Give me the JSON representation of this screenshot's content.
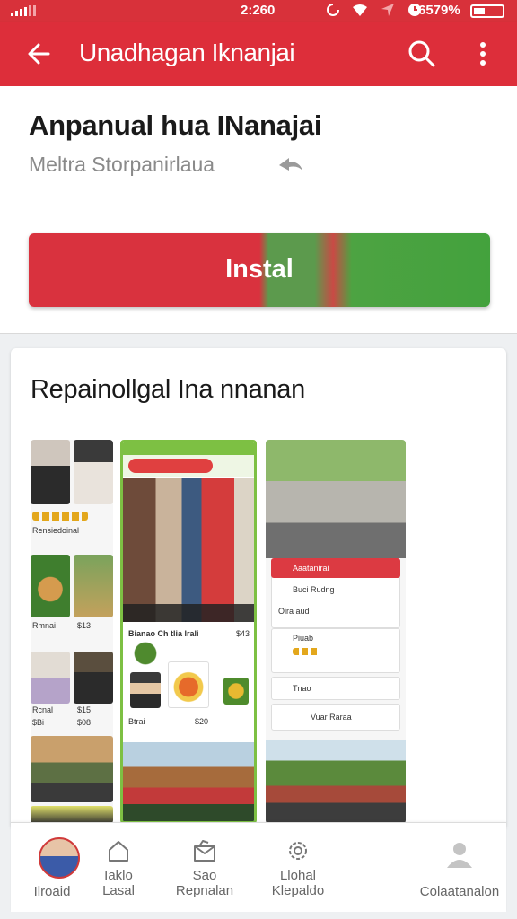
{
  "status_bar": {
    "time": "2:260",
    "battery": "6579%"
  },
  "app_bar": {
    "title": "Unadhagan Iknanjai",
    "icons": [
      "back-arrow-icon",
      "search-icon",
      "more-vert-icon"
    ]
  },
  "app_header": {
    "name": "Anpanual hua INanajai",
    "developer": "Meltra Storpanirlaua",
    "share_icon": "share-icon"
  },
  "install": {
    "label": "Instal",
    "colors": {
      "red": "#d9323e",
      "green": "#43a23d"
    }
  },
  "screenshots": {
    "title": "Repainollgal Ina nnanan",
    "shot1": {
      "row1": "Rensiedoinal",
      "row2a": "Rmnai",
      "row2b": "$13",
      "row3a": "Rcnal",
      "row3b": "$15",
      "row4a": "$Bi",
      "row4b": "$08"
    },
    "shot2": {
      "caption": "Bianao Ch tlia lrali",
      "price": "$43",
      "row1": "Btrai",
      "row2": "$20"
    },
    "shot3": {
      "card_title": "Aaatanirai",
      "item1": "Buci Rudng",
      "item2": "Oira aud",
      "item3": "Piuab",
      "item4": "Tnao",
      "item5": "Vuar Raraa"
    }
  },
  "bottom_nav": {
    "items": [
      {
        "label": "Ilroaid",
        "icon": "avatar"
      },
      {
        "label": "Iaklo\nLasal",
        "icon": "home-icon"
      },
      {
        "label": "Sao\nRepnalan",
        "icon": "inbox-icon"
      },
      {
        "label": "Llohal\nKlepaldo",
        "icon": "gear-icon"
      },
      {
        "label": "Colaatanalon",
        "icon": "person-icon"
      }
    ]
  }
}
